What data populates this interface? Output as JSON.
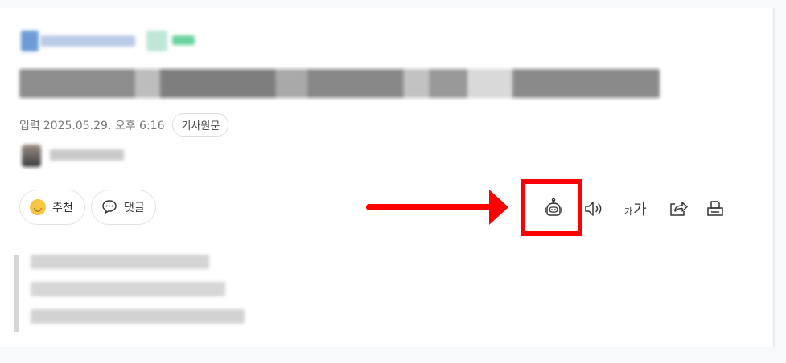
{
  "article": {
    "published_label": "입력",
    "published_time": "2025.05.29. 오후 6:16",
    "original_article_button": "기사원문"
  },
  "actions": {
    "recommend_label": "추천",
    "comment_label": "댓글"
  },
  "toolbar": {
    "font_size_small": "가",
    "font_size_large": "가",
    "icons": [
      "robot-icon",
      "speaker-icon",
      "font-size-icon",
      "share-icon",
      "print-icon"
    ]
  },
  "annotation": {
    "highlight_color": "#ff0000",
    "target": "robot-icon"
  }
}
